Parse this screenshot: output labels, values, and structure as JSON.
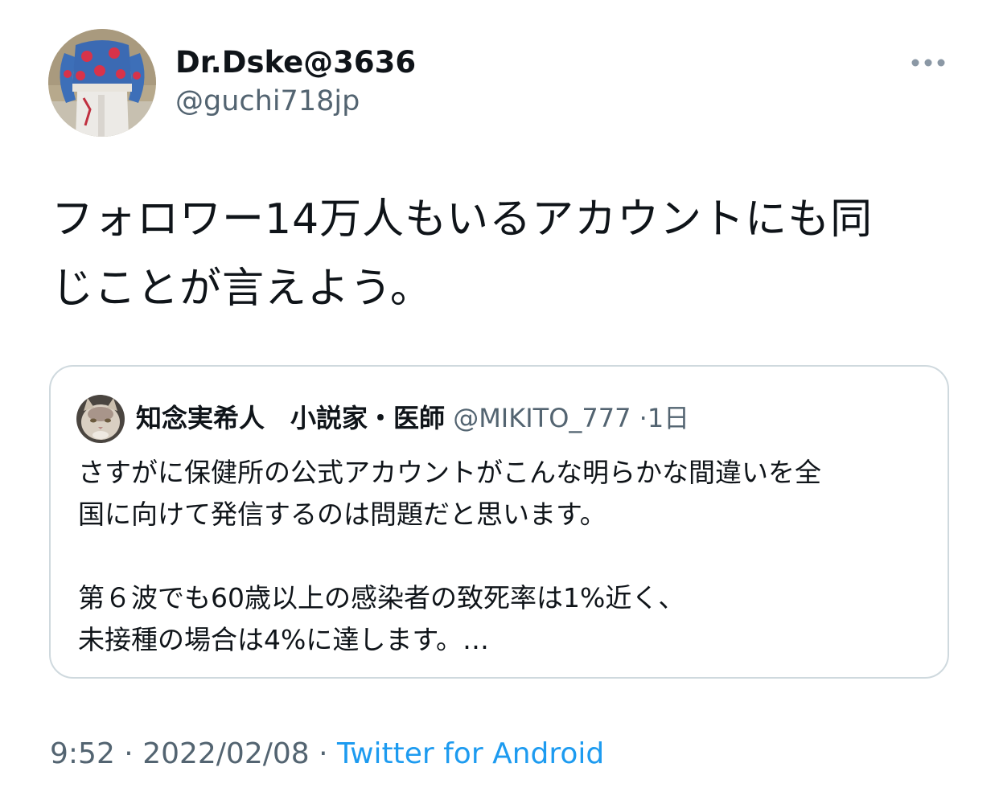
{
  "author": {
    "display_name": "Dr.Dske@3636",
    "handle": "@guchi718jp"
  },
  "tweet": {
    "text_line1": "フォロワー14万人もいるアカウントにも同",
    "text_line2": "じことが言えよう。"
  },
  "quoted_tweet": {
    "display_name": "知念実希人　小説家・医師",
    "handle": "@MIKITO_777",
    "separator": "·",
    "time": "1日",
    "paragraph1_line1": "さすがに保健所の公式アカウントがこんな明らかな間違いを全",
    "paragraph1_line2": "国に向けて発信するのは問題だと思います。",
    "paragraph2_line1": "第６波でも60歳以上の感染者の致死率は1%近く、",
    "paragraph2_line2": "未接種の場合は4%に達します。…"
  },
  "meta": {
    "time": "9:52",
    "separator": " · ",
    "date": "2022/02/08",
    "source": "Twitter for Android"
  },
  "icons": {
    "more": "more-icon",
    "author_avatar": "avatar",
    "quoted_avatar": "cat-avatar"
  },
  "colors": {
    "text": "#0f1419",
    "secondary": "#536471",
    "link": "#1d9bf0",
    "border": "#cfd9de"
  }
}
